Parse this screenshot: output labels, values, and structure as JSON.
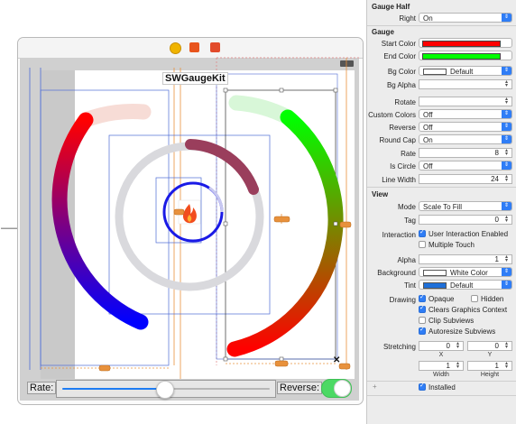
{
  "canvas": {
    "title_label": "SWGaugeKit",
    "rate_label": "Rate:",
    "reverse_label": "Reverse:",
    "slider_value": 0.5,
    "reverse_on": true,
    "gauges": {
      "left_half": {
        "start_color": "#ff0000",
        "end_color": "#0000ff",
        "value_fraction": 0.55
      },
      "right_half": {
        "start_color": "#00ff00",
        "end_color": "#ff0000",
        "value_fraction": 0.8
      },
      "center_ring": {
        "color": "#9a3e5c",
        "track": "#d9d9dd"
      },
      "small_ring": {
        "color": "#1a1ae6"
      }
    },
    "icons": [
      "first-responder-icon",
      "view-controller-icon",
      "exit-icon",
      "flame-image-icon"
    ]
  },
  "inspector": {
    "gauge_half": {
      "title": "Gauge Half",
      "right_label": "Right",
      "right_value": "On"
    },
    "gauge": {
      "title": "Gauge",
      "start_color_label": "Start Color",
      "start_color": "#ff0000",
      "end_color_label": "End Color",
      "end_color": "#00ff00",
      "bg_color_label": "Bg Color",
      "bg_color_value": "Default",
      "bg_alpha_label": "Bg Alpha",
      "rotate_label": "Rotate",
      "custom_colors_label": "Custom Colors",
      "custom_colors_value": "Off",
      "reverse_label": "Reverse",
      "reverse_value": "Off",
      "round_cap_label": "Round Cap",
      "round_cap_value": "On",
      "rate_label": "Rate",
      "rate_value": "8",
      "is_circle_label": "Is Circle",
      "is_circle_value": "Off",
      "line_width_label": "Line Width",
      "line_width_value": "24"
    },
    "view": {
      "title": "View",
      "mode_label": "Mode",
      "mode_value": "Scale To Fill",
      "tag_label": "Tag",
      "tag_value": "0",
      "interaction_label": "Interaction",
      "user_interaction": "User Interaction Enabled",
      "multiple_touch": "Multiple Touch",
      "alpha_label": "Alpha",
      "alpha_value": "1",
      "background_label": "Background",
      "background_value": "White Color",
      "tint_label": "Tint",
      "tint_value": "Default",
      "tint_color": "#1e6fd9",
      "drawing_label": "Drawing",
      "opaque": "Opaque",
      "hidden": "Hidden",
      "clears_graphics": "Clears Graphics Context",
      "clip_subviews": "Clip Subviews",
      "autoresize": "Autoresize Subviews",
      "stretching_label": "Stretching",
      "stretch_x": "0",
      "stretch_y": "0",
      "stretch_x_label": "X",
      "stretch_y_label": "Y",
      "stretch_w": "1",
      "stretch_h": "1",
      "width_label": "Width",
      "height_label": "Height",
      "installed": "Installed"
    }
  }
}
